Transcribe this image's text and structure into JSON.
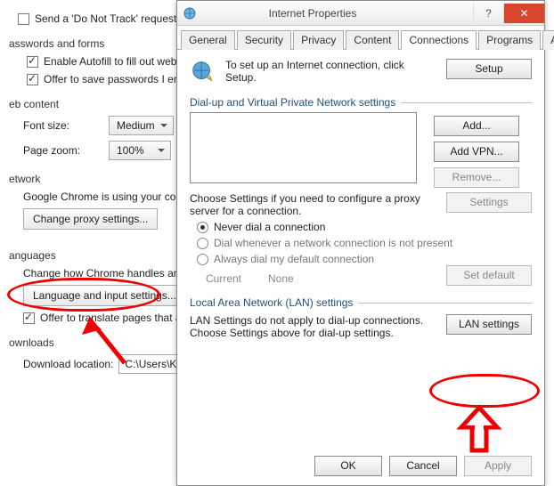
{
  "chrome": {
    "dnt": "Send a 'Do Not Track' request with your browsing traffic",
    "section_pwd": "asswords and forms",
    "autofill": "Enable Autofill to fill out web forms in a single click.",
    "savepwd": "Offer to save passwords I enter on the web.",
    "section_web": "eb content",
    "fontlabel": "Font size:",
    "fontval": "Medium",
    "zoomlabel": "Page zoom:",
    "zoomval": "100%",
    "section_net": "etwork",
    "netdesc": "Google Chrome is using your computer's system proxy settings.",
    "proxybtn": "Change proxy settings...",
    "section_lang": "anguages",
    "langdesc": "Change how Chrome handles and displays languages.",
    "langbtn": "Language and input settings...",
    "translate": "Offer to translate pages that aren't in a language you read.",
    "section_dl": "ownloads",
    "dlloc": "Download location:",
    "dlpath": "C:\\Users\\Kara"
  },
  "dialog": {
    "title": "Internet Properties",
    "help": "?",
    "close": "✕",
    "tabs": {
      "general": "General",
      "security": "Security",
      "privacy": "Privacy",
      "content": "Content",
      "connections": "Connections",
      "programs": "Programs",
      "advanced": "Advanced"
    },
    "setup_text": "To set up an Internet connection, click Setup.",
    "setup_btn": "Setup",
    "dialup_header": "Dial-up and Virtual Private Network settings",
    "add": "Add...",
    "addvpn": "Add VPN...",
    "remove": "Remove...",
    "choose_text": "Choose Settings if you need to configure a proxy server for a connection.",
    "settings_btn": "Settings",
    "radio_never": "Never dial a connection",
    "radio_dial": "Dial whenever a network connection is not present",
    "radio_always": "Always dial my default connection",
    "current": "Current",
    "none": "None",
    "setdefault": "Set default",
    "lan_header": "Local Area Network (LAN) settings",
    "lan_text": "LAN Settings do not apply to dial-up connections. Choose Settings above for dial-up settings.",
    "lan_btn": "LAN settings",
    "ok": "OK",
    "cancel": "Cancel",
    "apply": "Apply"
  }
}
